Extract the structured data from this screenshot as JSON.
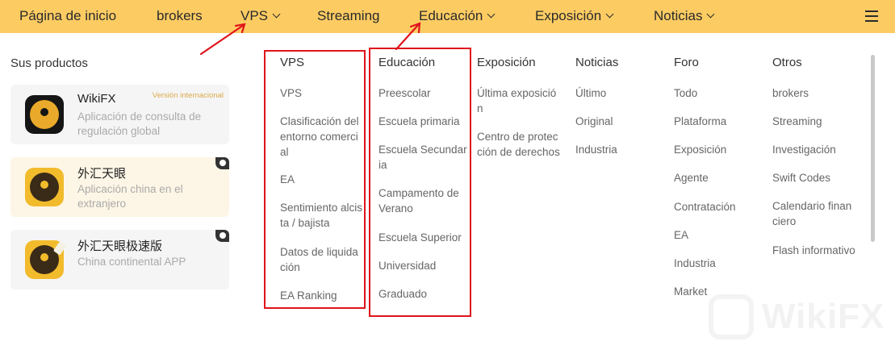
{
  "nav": {
    "items": [
      {
        "label": "Página de inicio",
        "chevron": false
      },
      {
        "label": "brokers",
        "chevron": false
      },
      {
        "label": "VPS",
        "chevron": true
      },
      {
        "label": "Streaming",
        "chevron": false
      },
      {
        "label": "Educación",
        "chevron": true
      },
      {
        "label": "Exposición",
        "chevron": true
      },
      {
        "label": "Noticias",
        "chevron": true
      }
    ],
    "menu_icon": "hamburger-icon",
    "bg_color": "#fccc63"
  },
  "products": {
    "title": "Sus productos",
    "apps": [
      {
        "name": "WikiFX",
        "desc": "Aplicación de consulta de regulación global",
        "tag": "Versión internacional"
      },
      {
        "name": "外汇天眼",
        "desc": "Aplicación china en el extranjero",
        "badge": "apple-icon"
      },
      {
        "name": "外汇天眼极速版",
        "desc": "China continental APP",
        "badge": "apple-icon"
      }
    ]
  },
  "menu": {
    "columns": [
      {
        "title": "VPS",
        "links": [
          "VPS",
          "Clasificación del\nentorno comerci\nal",
          "EA",
          "Sentimiento alcis\nta / bajista",
          "Datos de liquida\nción",
          "EA Ranking"
        ]
      },
      {
        "title": "Educación",
        "links": [
          "Preescolar",
          "Escuela primaria",
          "Escuela Secundar\nia",
          "Campamento de\nVerano",
          "Escuela Superior",
          "Universidad",
          "Graduado"
        ]
      },
      {
        "title": "Exposición",
        "links": [
          "Última exposició\nn",
          "Centro de protec\nción de derechos"
        ]
      },
      {
        "title": "Noticias",
        "links": [
          "Último",
          "Original",
          "Industria"
        ]
      },
      {
        "title": "Foro",
        "links": [
          "Todo",
          "Plataforma",
          "Exposición",
          "Agente",
          "Contratación",
          "EA",
          "Industria",
          "Market"
        ]
      },
      {
        "title": "Otros",
        "links": [
          "brokers",
          "Streaming",
          "Investigación",
          "Swift Codes",
          "Calendario finan\nciero",
          "Flash informativo"
        ]
      }
    ]
  },
  "watermark": {
    "text": "WikiFX"
  },
  "annotation_color": "#e0141b"
}
